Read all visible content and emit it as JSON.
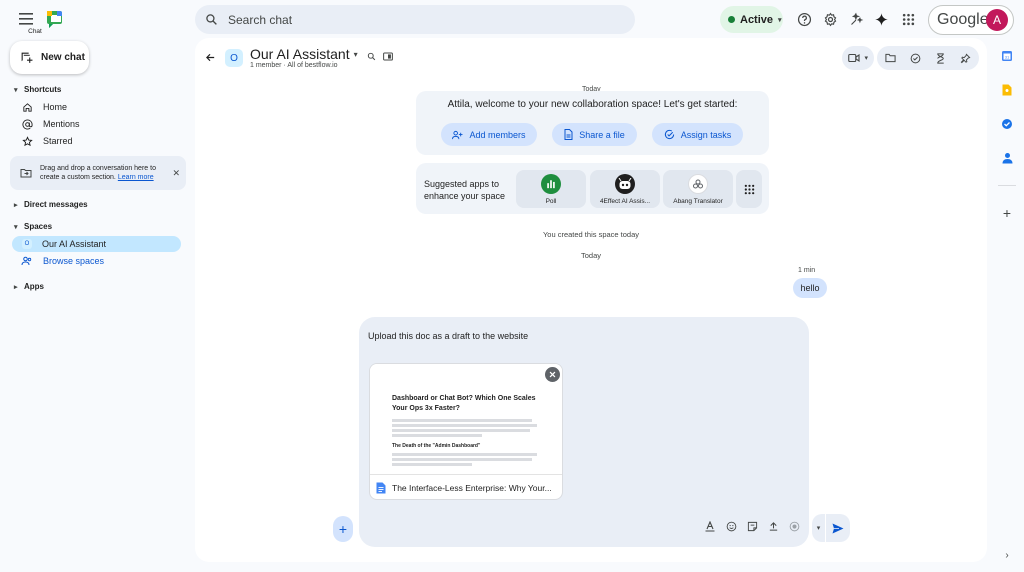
{
  "app": {
    "name": "Chat"
  },
  "search": {
    "placeholder": "Search chat"
  },
  "status": {
    "label": "Active",
    "color": "#188038"
  },
  "account": {
    "brand": "Google",
    "avatar_initial": "A"
  },
  "sidebar": {
    "new_chat": "New chat",
    "shortcuts_label": "Shortcuts",
    "shortcuts": [
      {
        "label": "Home",
        "icon": "home-icon"
      },
      {
        "label": "Mentions",
        "icon": "at-icon"
      },
      {
        "label": "Starred",
        "icon": "star-icon"
      }
    ],
    "drag_hint": "Drag and drop a conversation here to create a custom section.",
    "learn_more": "Learn more",
    "direct_messages_label": "Direct messages",
    "spaces_label": "Spaces",
    "active_space": {
      "badge": "O",
      "label": "Our AI Assistant"
    },
    "browse_spaces": "Browse spaces",
    "apps_label": "Apps"
  },
  "header": {
    "space_badge": "O",
    "title": "Our AI Assistant",
    "subtitle": "1 member  ·  All of bestflow.io"
  },
  "conversation": {
    "date_top": "Today",
    "welcome_title": "Attila, welcome to your new collaboration space! Let's get started:",
    "welcome_buttons": [
      "Add members",
      "Share a file",
      "Assign tasks"
    ],
    "suggested_apps_label": "Suggested apps to enhance your space",
    "apps": [
      {
        "name": "Poll"
      },
      {
        "name": "4Effect AI Assis..."
      },
      {
        "name": "Abang Translator"
      }
    ],
    "created_msg": "You created this space today",
    "date_mid": "Today",
    "message_time": "1 min",
    "message_text": "hello"
  },
  "composer": {
    "text": "Upload this doc as a draft to the website",
    "attachment": {
      "preview_title": "Dashboard or Chat Bot? Which One Scales Your Ops 3x Faster?",
      "preview_section": "The Death of the \"Admin Dashboard\"",
      "file_name": "The Interface-Less Enterprise: Why Your..."
    }
  },
  "colors": {
    "accent": "#0b57d0",
    "chip_bg": "#d3e3fd",
    "active_space_bg": "#c2e7ff",
    "poll_green": "#1e8e3e",
    "avatar_bg": "#c2185b"
  }
}
